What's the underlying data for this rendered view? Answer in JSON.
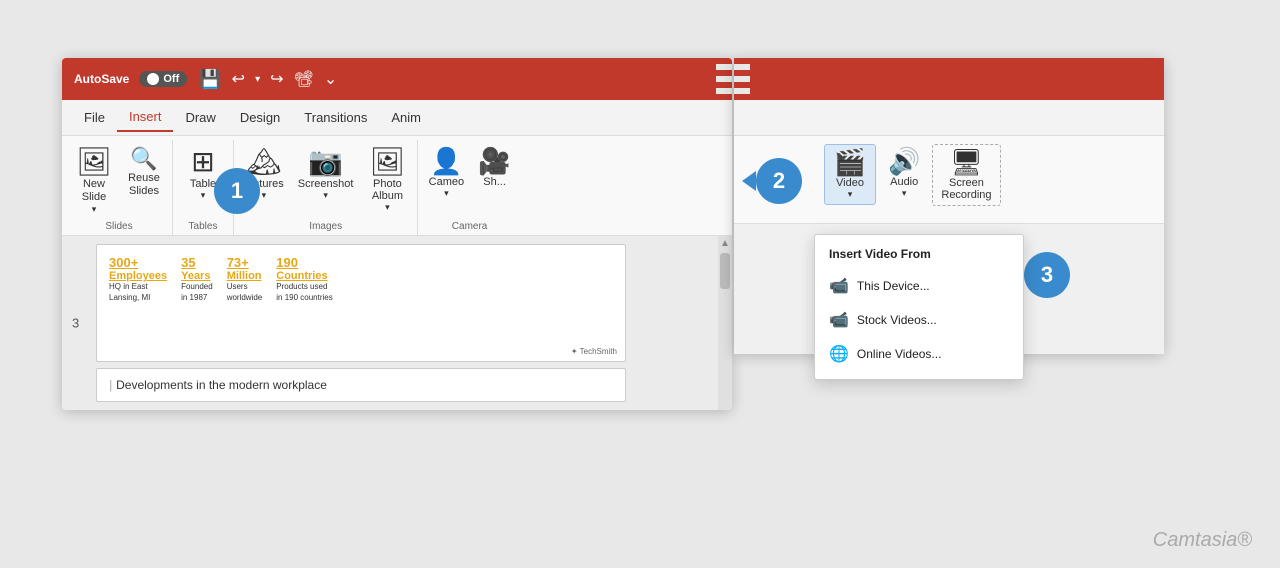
{
  "left_panel": {
    "autosave_label": "AutoSave",
    "toggle_label": "Off",
    "tabs": [
      "File",
      "Insert",
      "Draw",
      "Design",
      "Transitions",
      "Anim"
    ],
    "active_tab": "Insert",
    "groups": [
      {
        "name": "Slides",
        "buttons": [
          {
            "id": "new-slide",
            "label": "New\nSlide",
            "icon": "🖼",
            "has_arrow": true
          },
          {
            "id": "reuse-slides",
            "label": "Reuse\nSlides",
            "icon": "🔍"
          }
        ]
      },
      {
        "name": "Tables",
        "buttons": [
          {
            "id": "table",
            "label": "Table",
            "icon": "⊞",
            "has_arrow": true
          }
        ]
      },
      {
        "name": "Images",
        "buttons": [
          {
            "id": "pictures",
            "label": "Pictures",
            "icon": "🏔",
            "has_arrow": true
          },
          {
            "id": "screenshot",
            "label": "Screenshot",
            "icon": "📷",
            "has_arrow": true
          },
          {
            "id": "photo-album",
            "label": "Photo\nAlbum",
            "icon": "🖼",
            "has_arrow": true
          }
        ]
      },
      {
        "name": "Camera",
        "buttons": [
          {
            "id": "cameo",
            "label": "Cameo",
            "icon": "👤",
            "has_arrow": true
          },
          {
            "id": "sh",
            "label": "Sh...",
            "icon": "🎥"
          }
        ]
      }
    ],
    "slide": {
      "stats": [
        {
          "number": "300+",
          "label": "Employees",
          "desc": "HQ in East\nLansing, MI"
        },
        {
          "number": "35",
          "label": "Years",
          "desc": "Founded\nin 1987"
        },
        {
          "number": "73+",
          "label": "Million",
          "desc": "Users\nworldwide"
        },
        {
          "number": "190",
          "label": "Countries",
          "desc": "Products used\nin 190 countries"
        }
      ],
      "slide_number": "3",
      "footer": "✦ TechSmith",
      "title": "Developments in the modern workplace"
    }
  },
  "right_panel": {
    "ribbon_buttons": [
      {
        "id": "video",
        "label": "Video",
        "icon": "🎬",
        "has_arrow": true,
        "selected": true
      },
      {
        "id": "audio",
        "label": "Audio",
        "icon": "🔊",
        "has_arrow": true
      },
      {
        "id": "screen-recording",
        "label": "Screen\nRecording",
        "icon": "🖥",
        "dashed": true
      }
    ],
    "dropdown": {
      "title": "Insert Video From",
      "items": [
        {
          "id": "this-device",
          "label": "This Device...",
          "icon": "🎬"
        },
        {
          "id": "stock-videos",
          "label": "Stock Videos...",
          "icon": "🎬"
        },
        {
          "id": "online-videos",
          "label": "Online Videos...",
          "icon": "🌐"
        }
      ]
    }
  },
  "callouts": [
    {
      "number": "1"
    },
    {
      "number": "2"
    },
    {
      "number": "3"
    }
  ],
  "camtasia_label": "Camtasia®"
}
